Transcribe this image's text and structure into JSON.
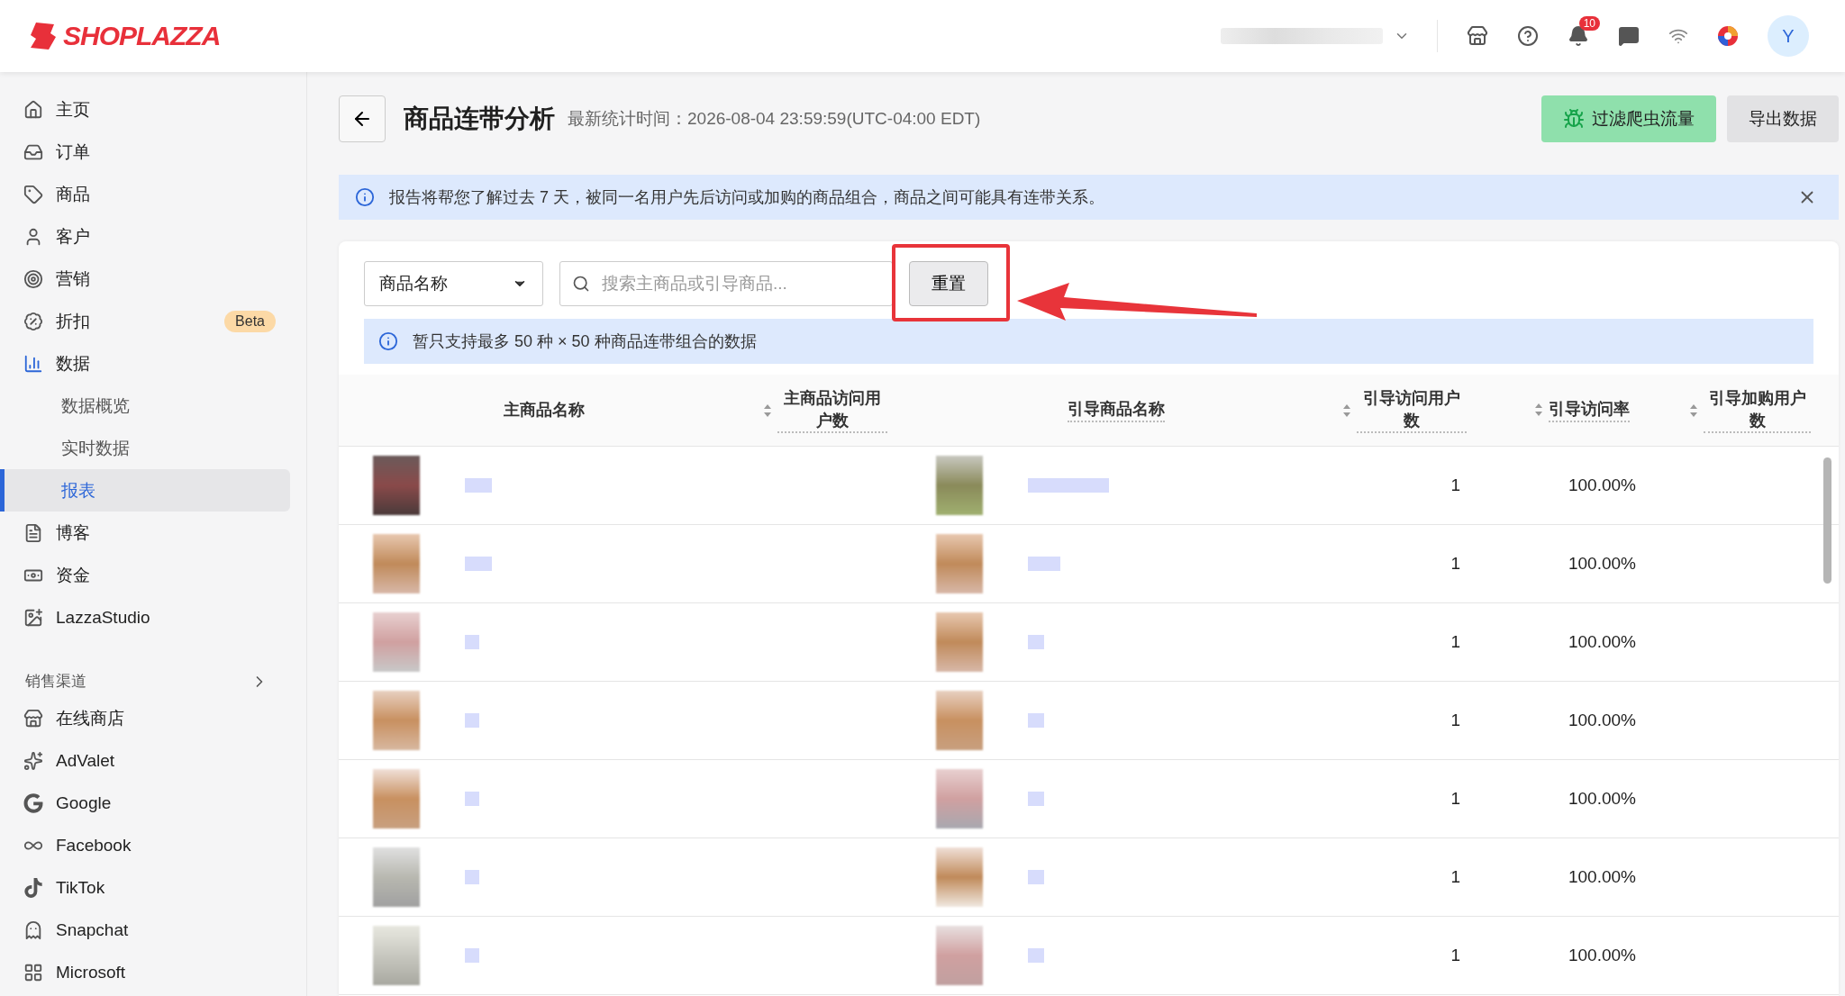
{
  "header": {
    "logo": "SHOPLAZZA",
    "notification_count": "10",
    "avatar": "Y"
  },
  "sidebar": {
    "items": [
      {
        "label": "主页",
        "selected": false
      },
      {
        "label": "订单",
        "selected": false
      },
      {
        "label": "商品",
        "selected": false
      },
      {
        "label": "客户",
        "selected": false
      },
      {
        "label": "营销",
        "selected": false
      },
      {
        "label": "折扣",
        "selected": false,
        "badge": "Beta"
      },
      {
        "label": "数据",
        "selected": false,
        "expanded": true,
        "children": [
          {
            "label": "数据概览",
            "selected": false
          },
          {
            "label": "实时数据",
            "selected": false
          },
          {
            "label": "报表",
            "selected": true
          }
        ]
      },
      {
        "label": "博客",
        "selected": false
      },
      {
        "label": "资金",
        "selected": false
      },
      {
        "label": "LazzaStudio",
        "selected": false
      }
    ],
    "section_title": "销售渠道",
    "channels": [
      {
        "label": "在线商店",
        "selected": false
      },
      {
        "label": "AdValet",
        "selected": false
      },
      {
        "label": "Google",
        "selected": false
      },
      {
        "label": "Facebook",
        "selected": false
      },
      {
        "label": "TikTok",
        "selected": false
      },
      {
        "label": "Snapchat",
        "selected": false
      },
      {
        "label": "Microsoft",
        "selected": false
      }
    ]
  },
  "page": {
    "title": "商品连带分析",
    "subtitle": "最新统计时间：2026-08-04 23:59:59(UTC-04:00 EDT)",
    "buttons": [
      {
        "label": "过滤爬虫流量",
        "kind": "bot"
      },
      {
        "label": "导出数据",
        "kind": "plain"
      }
    ]
  },
  "banner": {
    "text": "报告将帮您了解过去 7 天，被同一名用户先后访问或加购的商品组合，商品之间可能具有连带关系。"
  },
  "filter": {
    "select": "商品名称",
    "search": {
      "placeholder": "搜索主商品或引导商品..."
    },
    "reset": "重置",
    "note": "暂只支持最多 50 种 × 50 种商品连带组合的数据"
  },
  "table": {
    "columns": [
      {
        "label": "主商品名称",
        "sortable": false,
        "hint": false
      },
      {
        "label": "主商品访问用户数",
        "sortable": true,
        "hint": true
      },
      {
        "label": "引导商品名称",
        "sortable": false,
        "hint": true
      },
      {
        "label": "引导访问用户数",
        "sortable": true,
        "hint": true
      },
      {
        "label": "引导访问率",
        "sortable": true,
        "hint": true
      },
      {
        "label": "引导加购用户数",
        "sortable": true,
        "hint": true
      }
    ],
    "rows": [
      {
        "guide_visitors": "1",
        "guide_visit_rate": "100.00%"
      },
      {
        "guide_visitors": "1",
        "guide_visit_rate": "100.00%"
      },
      {
        "guide_visitors": "1",
        "guide_visit_rate": "100.00%"
      },
      {
        "guide_visitors": "1",
        "guide_visit_rate": "100.00%"
      },
      {
        "guide_visitors": "1",
        "guide_visit_rate": "100.00%"
      },
      {
        "guide_visitors": "1",
        "guide_visit_rate": "100.00%"
      },
      {
        "guide_visitors": "1",
        "guide_visit_rate": "100.00%"
      }
    ]
  }
}
